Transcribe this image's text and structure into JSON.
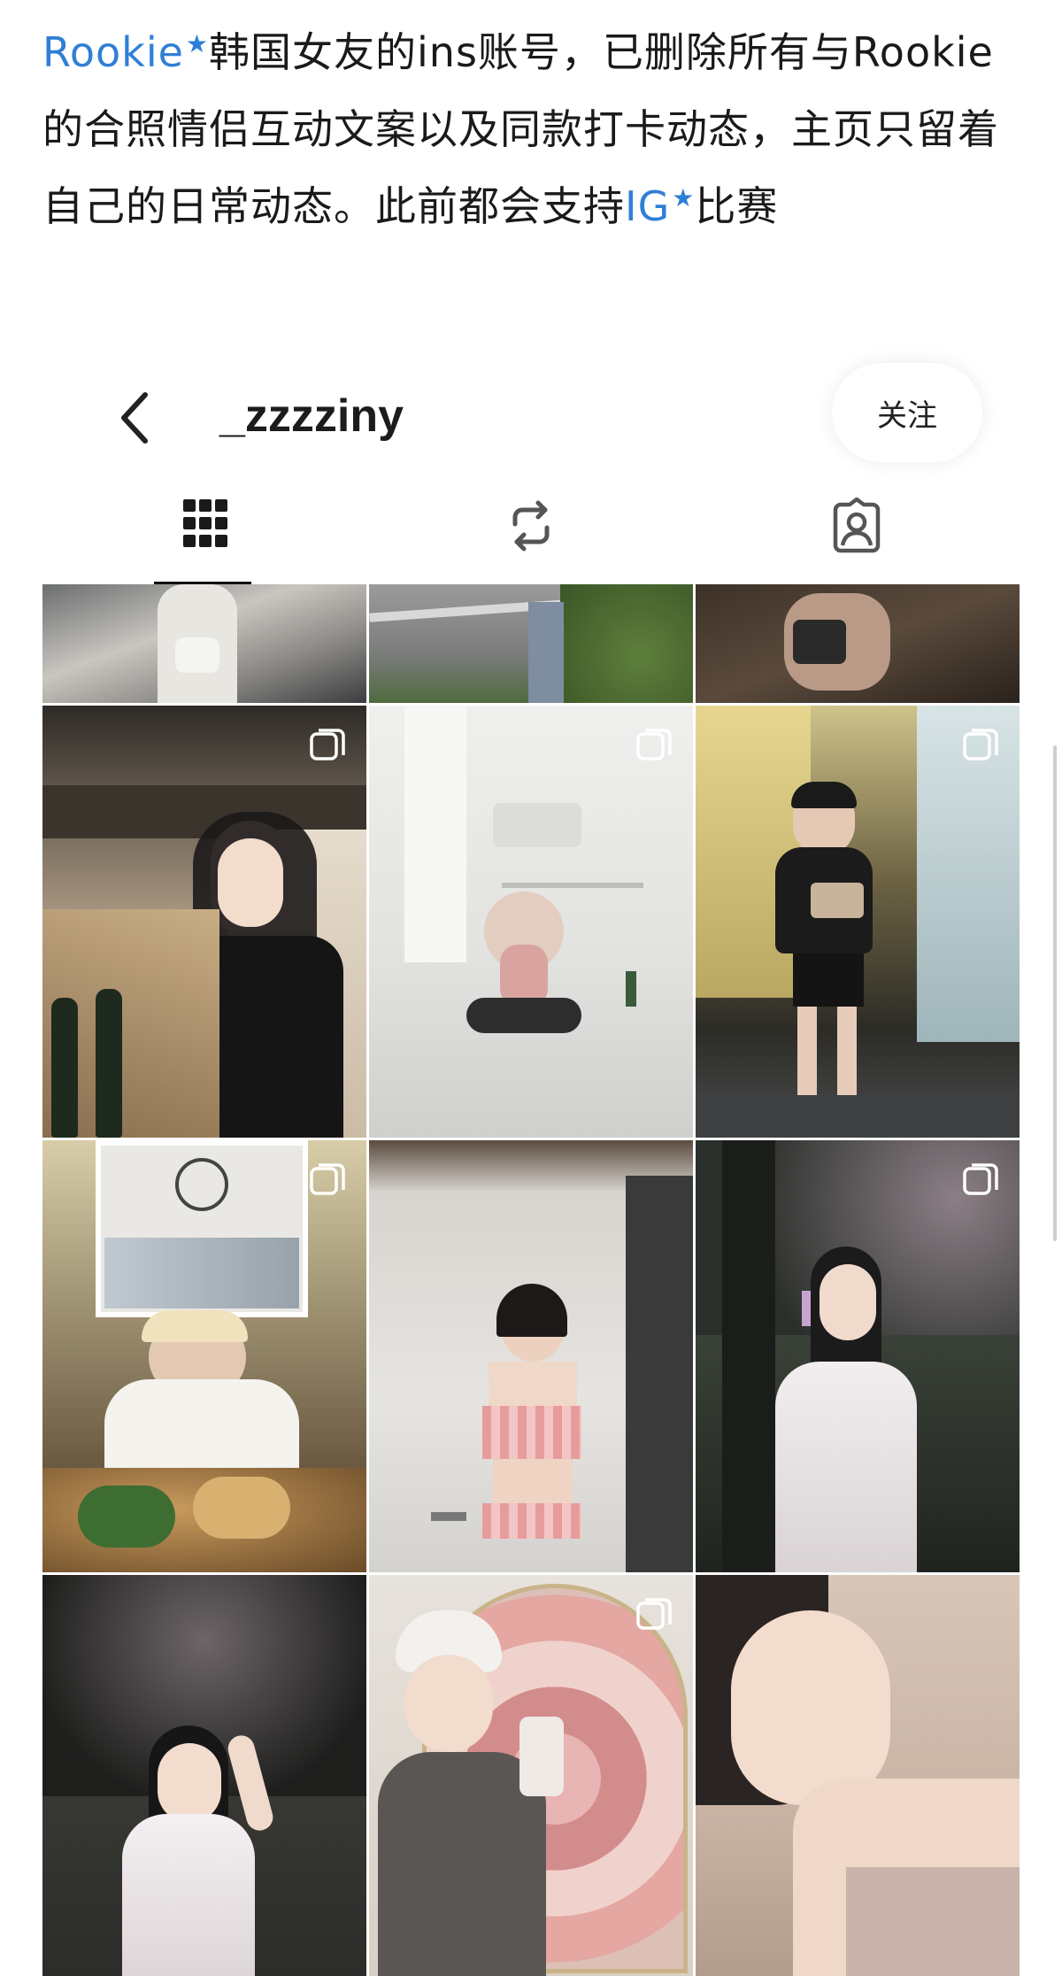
{
  "post": {
    "tag1": "Rookie",
    "text1": "韩国女友的ins账号，已删除所有与Rookie的合照情侣互动文案以及同款打卡动态，主页只留着自己的日常动态。此前都会支持",
    "tag2": "IG",
    "text2": "比赛",
    "star": "★"
  },
  "profile": {
    "username": "_zzzziny",
    "follow_label": "关注"
  },
  "colors": {
    "link": "#2f7fd6",
    "text": "#1a1a1a"
  },
  "tabs": [
    {
      "icon": "grid-icon",
      "active": true
    },
    {
      "icon": "reels-repost-icon",
      "active": false
    },
    {
      "icon": "tagged-person-icon",
      "active": false
    }
  ],
  "grid": {
    "multi_photo_indicator": "carousel-icon"
  }
}
